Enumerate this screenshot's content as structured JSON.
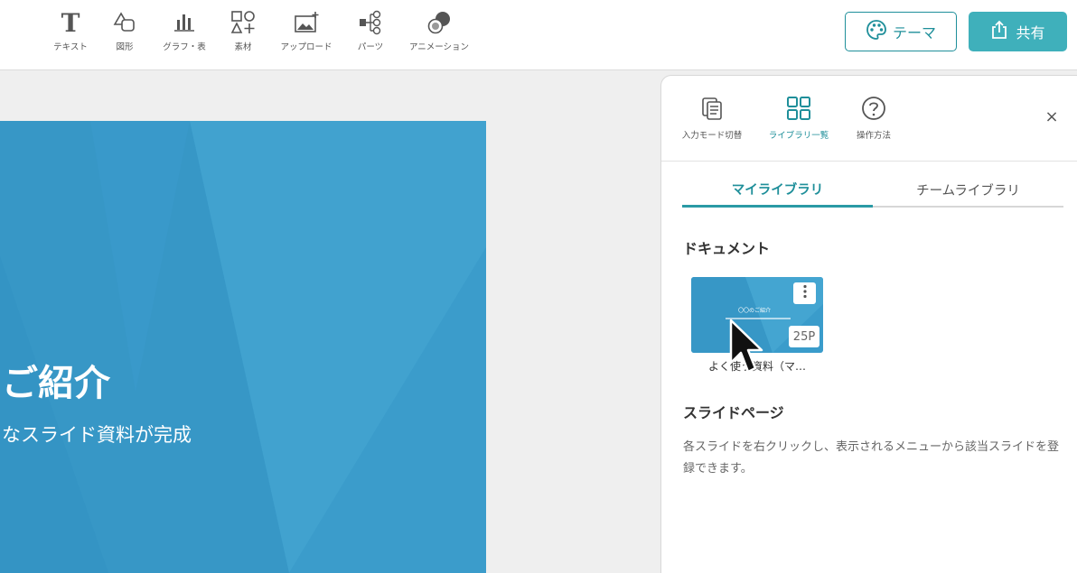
{
  "toolbar": {
    "tools": [
      {
        "label": "テキスト",
        "icon": "text-icon"
      },
      {
        "label": "図形",
        "icon": "shape-icon"
      },
      {
        "label": "グラフ・表",
        "icon": "chart-icon"
      },
      {
        "label": "素材",
        "icon": "material-icon"
      },
      {
        "label": "アップロード",
        "icon": "upload-image-icon"
      },
      {
        "label": "パーツ",
        "icon": "parts-icon"
      },
      {
        "label": "アニメーション",
        "icon": "animation-icon"
      }
    ],
    "theme_label": "テーマ",
    "share_label": "共有"
  },
  "slide": {
    "title": "ご紹介",
    "subtitle": "なスライド資料が完成"
  },
  "panel": {
    "tools": [
      {
        "label": "入力モード切替",
        "icon": "input-mode-icon"
      },
      {
        "label": "ライブラリ一覧",
        "icon": "library-grid-icon"
      },
      {
        "label": "操作方法",
        "icon": "help-icon"
      }
    ],
    "close_label": "×",
    "tabs": [
      {
        "label": "マイライブラリ",
        "active": true
      },
      {
        "label": "チームライブラリ",
        "active": false
      }
    ],
    "documents_heading": "ドキュメント",
    "document": {
      "thumb_title": "〇〇のご紹介",
      "pages": "25P",
      "name": "よく使う資料（マ…"
    },
    "slides_heading": "スライドページ",
    "slides_description": "各スライドを右クリックし、表示されるメニューから該当スライドを登録できます。"
  },
  "colors": {
    "accent": "#1f8f9a",
    "share_bg": "#3fb0bb",
    "slide_bg": "#3a9ccb"
  }
}
